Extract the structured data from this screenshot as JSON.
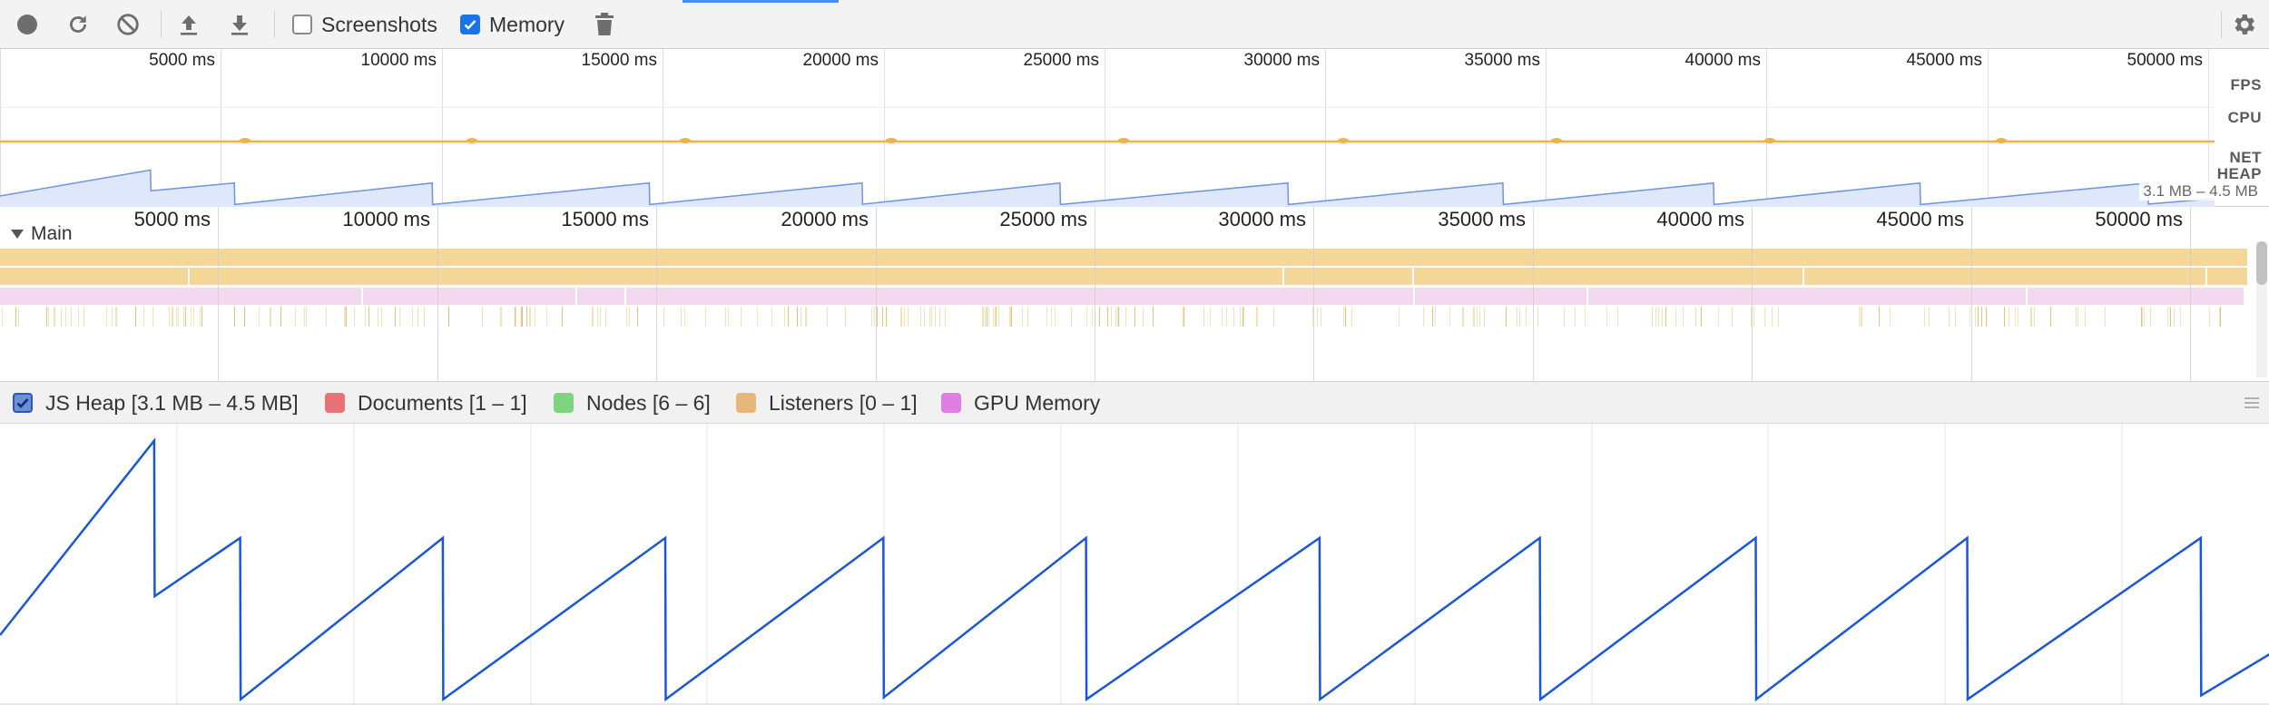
{
  "toolbar": {
    "buttons": [
      {
        "name": "record-icon"
      },
      {
        "name": "reload-icon"
      },
      {
        "name": "clear-icon"
      },
      {
        "name": "load-profile-icon"
      },
      {
        "name": "save-profile-icon"
      }
    ],
    "screenshots": {
      "label": "Screenshots",
      "checked": false
    },
    "memory": {
      "label": "Memory",
      "checked": true
    },
    "trash_icon": "trash-icon",
    "settings_icon": "gear-icon"
  },
  "overview": {
    "ticks": [
      "5000 ms",
      "10000 ms",
      "15000 ms",
      "20000 ms",
      "25000 ms",
      "30000 ms",
      "35000 ms",
      "40000 ms",
      "45000 ms",
      "50000 ms"
    ],
    "rows": {
      "fps": "FPS",
      "cpu": "CPU",
      "net": "NET",
      "heap": "HEAP"
    },
    "heap_range": "3.1 MB – 4.5 MB"
  },
  "main": {
    "label": "Main",
    "ticks": [
      "5000 ms",
      "10000 ms",
      "15000 ms",
      "20000 ms",
      "25000 ms",
      "30000 ms",
      "35000 ms",
      "40000 ms",
      "45000 ms",
      "50000 ms"
    ]
  },
  "legend": {
    "items": [
      {
        "label": "JS Heap [3.1 MB – 4.5 MB]",
        "color": "#1a57d6",
        "checked": true
      },
      {
        "label": "Documents [1 – 1]",
        "color": "#e57373",
        "checked": false
      },
      {
        "label": "Nodes [6 – 6]",
        "color": "#7ed37e",
        "checked": false
      },
      {
        "label": "Listeners [0 – 1]",
        "color": "#e8b777",
        "checked": false
      },
      {
        "label": "GPU Memory",
        "color": "#e07de0",
        "checked": false
      }
    ]
  },
  "chart_data": {
    "type": "line",
    "series": [
      {
        "name": "JS Heap",
        "color": "#1a57d6"
      }
    ],
    "x_unit": "ms",
    "x_range": [
      0,
      51500
    ],
    "ylim": [
      3.1,
      4.5
    ],
    "y_unit": "MB",
    "sawtooth_cycles": [
      {
        "start_ms": 0,
        "peak_ms": 3500,
        "start_mb": 3.45,
        "peak_mb": 4.45,
        "drop_to_mb": 3.65
      },
      {
        "start_ms": 3500,
        "peak_ms": 5450,
        "start_mb": 3.65,
        "peak_mb": 3.95,
        "drop_to_mb": 3.12
      },
      {
        "start_ms": 5450,
        "peak_ms": 10050,
        "start_mb": 3.12,
        "peak_mb": 3.95,
        "drop_to_mb": 3.12
      },
      {
        "start_ms": 10050,
        "peak_ms": 15100,
        "start_mb": 3.12,
        "peak_mb": 3.95,
        "drop_to_mb": 3.12
      },
      {
        "start_ms": 15100,
        "peak_ms": 20050,
        "start_mb": 3.12,
        "peak_mb": 3.95,
        "drop_to_mb": 3.13
      },
      {
        "start_ms": 20050,
        "peak_ms": 24650,
        "start_mb": 3.13,
        "peak_mb": 3.95,
        "drop_to_mb": 3.12
      },
      {
        "start_ms": 24650,
        "peak_ms": 29950,
        "start_mb": 3.12,
        "peak_mb": 3.95,
        "drop_to_mb": 3.12
      },
      {
        "start_ms": 29950,
        "peak_ms": 34950,
        "start_mb": 3.12,
        "peak_mb": 3.95,
        "drop_to_mb": 3.12
      },
      {
        "start_ms": 34950,
        "peak_ms": 39850,
        "start_mb": 3.12,
        "peak_mb": 3.95,
        "drop_to_mb": 3.12
      },
      {
        "start_ms": 39850,
        "peak_ms": 44650,
        "start_mb": 3.12,
        "peak_mb": 3.95,
        "drop_to_mb": 3.12
      },
      {
        "start_ms": 44650,
        "peak_ms": 49950,
        "start_mb": 3.12,
        "peak_mb": 3.95,
        "drop_to_mb": 3.14
      },
      {
        "start_ms": 49950,
        "peak_ms": 51500,
        "start_mb": 3.14,
        "peak_mb": 3.35,
        "drop_to_mb": 3.35
      }
    ]
  }
}
